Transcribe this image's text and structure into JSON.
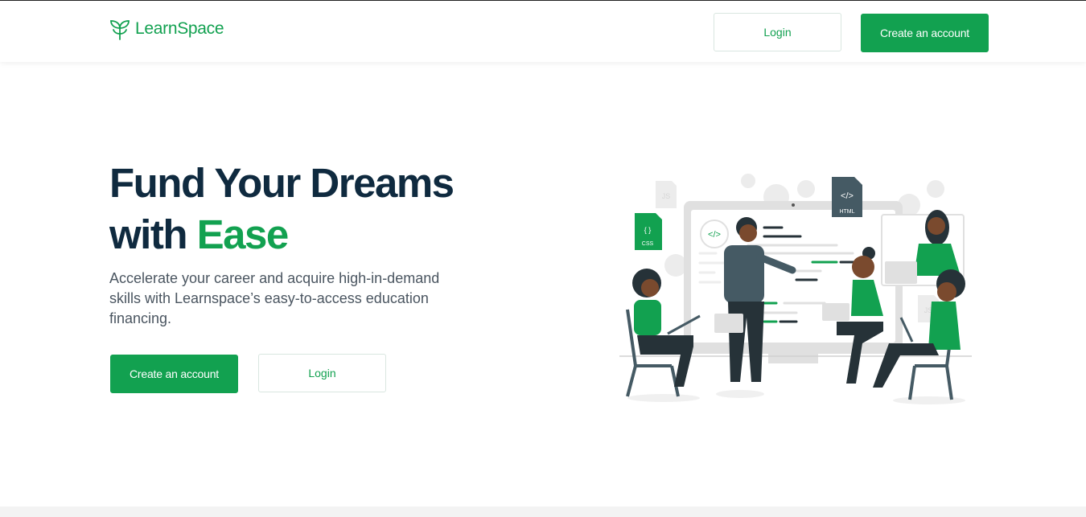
{
  "header": {
    "brand": "LearnSpace",
    "login_label": "Login",
    "create_account_label": "Create an account"
  },
  "hero": {
    "title_line1": "Fund Your Dreams",
    "title_line2_prefix": "with ",
    "title_line2_accent": "Ease",
    "subtitle": "Accelerate your career and acquire high-in-demand skills with Learnspace’s easy-to-access education financing.",
    "create_account_label": "Create an account",
    "login_label": "Login"
  },
  "illustration": {
    "file_badges": {
      "css_glyph": "{ }",
      "css_label": "CSS",
      "html_glyph": "</>",
      "html_label": "HTML",
      "js_label": "JS",
      "code_bubble": "</>"
    }
  },
  "colors": {
    "brand_green": "#12a150",
    "heading_navy": "#0f2a3f",
    "body_text": "#4a5560"
  }
}
